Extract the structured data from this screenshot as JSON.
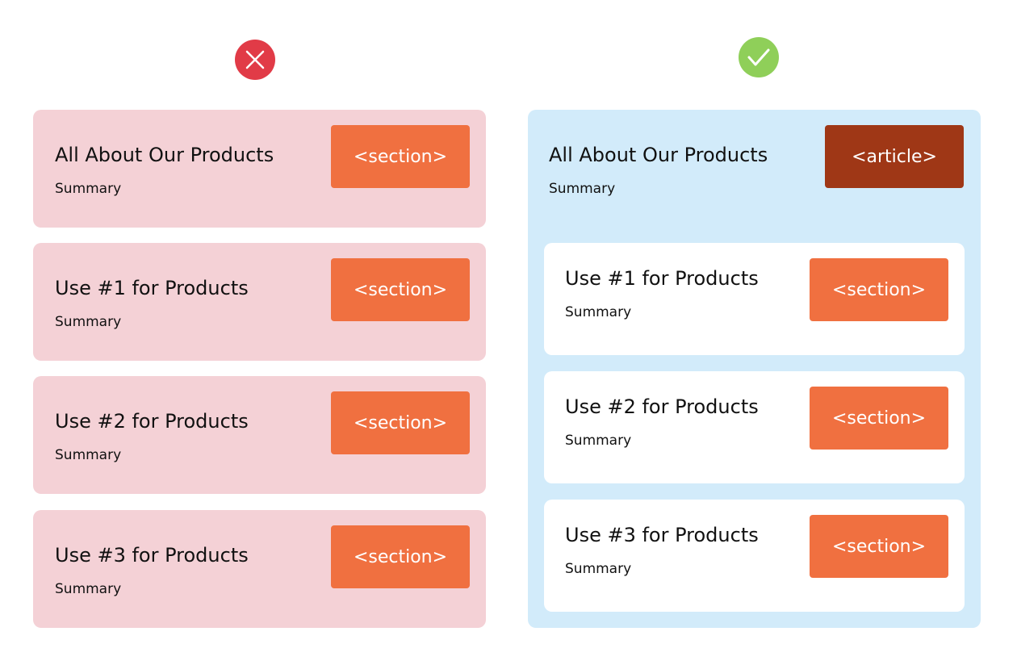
{
  "colors": {
    "wrong_icon": "#e13b47",
    "correct_icon": "#8fcf59",
    "bad_card_bg": "#f4d1d6",
    "article_bg": "#d2ebfa",
    "section_tag": "#f07040",
    "article_tag": "#9f3716"
  },
  "icons": {
    "wrong": "x-circle-icon",
    "correct": "check-circle-icon"
  },
  "wrong_example": {
    "cards": [
      {
        "title": "All About Our Products",
        "summary": "Summary",
        "tag": "<section>"
      },
      {
        "title": "Use #1 for Products",
        "summary": "Summary",
        "tag": "<section>"
      },
      {
        "title": "Use #2 for Products",
        "summary": "Summary",
        "tag": "<section>"
      },
      {
        "title": "Use #3 for Products",
        "summary": "Summary",
        "tag": "<section>"
      }
    ]
  },
  "correct_example": {
    "article": {
      "title": "All About Our Products",
      "summary": "Summary",
      "tag": "<article>"
    },
    "sections": [
      {
        "title": "Use #1 for Products",
        "summary": "Summary",
        "tag": "<section>"
      },
      {
        "title": "Use #2 for Products",
        "summary": "Summary",
        "tag": "<section>"
      },
      {
        "title": "Use #3 for Products",
        "summary": "Summary",
        "tag": "<section>"
      }
    ]
  }
}
